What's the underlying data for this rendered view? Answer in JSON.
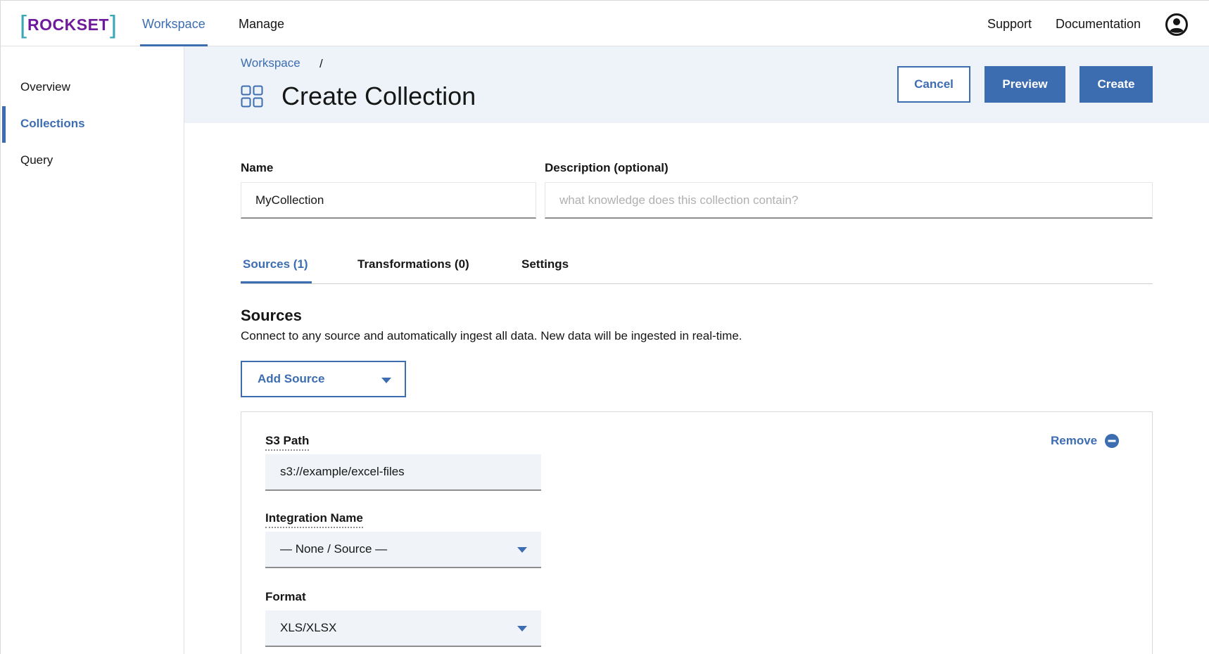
{
  "app": {
    "logo_text": "ROCKSET",
    "brand_color": "#6f1a9c",
    "accent_color": "#3d6db1"
  },
  "topnav": {
    "workspace": "Workspace",
    "manage": "Manage",
    "support": "Support",
    "documentation": "Documentation",
    "avatar_icon": "user-avatar-icon",
    "active": "Workspace"
  },
  "sidebar": {
    "items": [
      {
        "label": "Overview",
        "active": false
      },
      {
        "label": "Collections",
        "active": true
      },
      {
        "label": "Query",
        "active": false
      }
    ]
  },
  "header": {
    "breadcrumb": "Workspace",
    "breadcrumb_separator": "/",
    "title": "Create Collection",
    "title_icon": "grid-four-squares-icon",
    "cancel_label": "Cancel",
    "preview_label": "Preview",
    "create_label": "Create"
  },
  "form": {
    "name_label": "Name",
    "name_value": "MyCollection",
    "description_label": "Description (optional)",
    "description_placeholder": "what knowledge does this collection contain?"
  },
  "tabs": [
    {
      "label": "Sources (1)",
      "active": true
    },
    {
      "label": "Transformations (0)",
      "active": false
    },
    {
      "label": "Settings",
      "active": false
    }
  ],
  "sources": {
    "title": "Sources",
    "description": "Connect to any source and automatically ingest all data. New data will be ingested in real-time.",
    "add_source_label": "Add Source",
    "card": {
      "s3_path_label": "S3 Path",
      "s3_path_value": "s3://example/excel-files",
      "integration_label": "Integration Name",
      "integration_value": "— None / Source —",
      "format_label": "Format",
      "format_value": "XLS/XLSX",
      "remove_label": "Remove",
      "remove_icon": "minus-circle-icon"
    }
  }
}
